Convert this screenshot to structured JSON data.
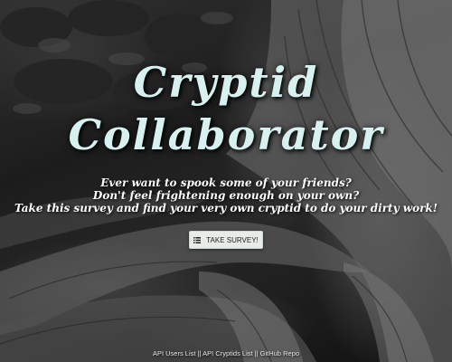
{
  "title": {
    "line1": "Cryptid",
    "line2": "Collaborator"
  },
  "tagline": {
    "line1": "Ever want to spook some of your friends?",
    "line2": "Don't feel frightening enough on your own?",
    "line3": "Take this survey and find your very own cryptid to do your dirty work!"
  },
  "survey_button": {
    "label": "TAKE SURVEY!",
    "icon": "list-icon"
  },
  "footer": {
    "links": [
      "API Users List",
      "API Cryptids List",
      "GitHub Repo"
    ],
    "separator": "||"
  },
  "colors": {
    "title": "#d6f1ef",
    "tagline": "#ffffff",
    "button_bg": "#e7ece9"
  }
}
